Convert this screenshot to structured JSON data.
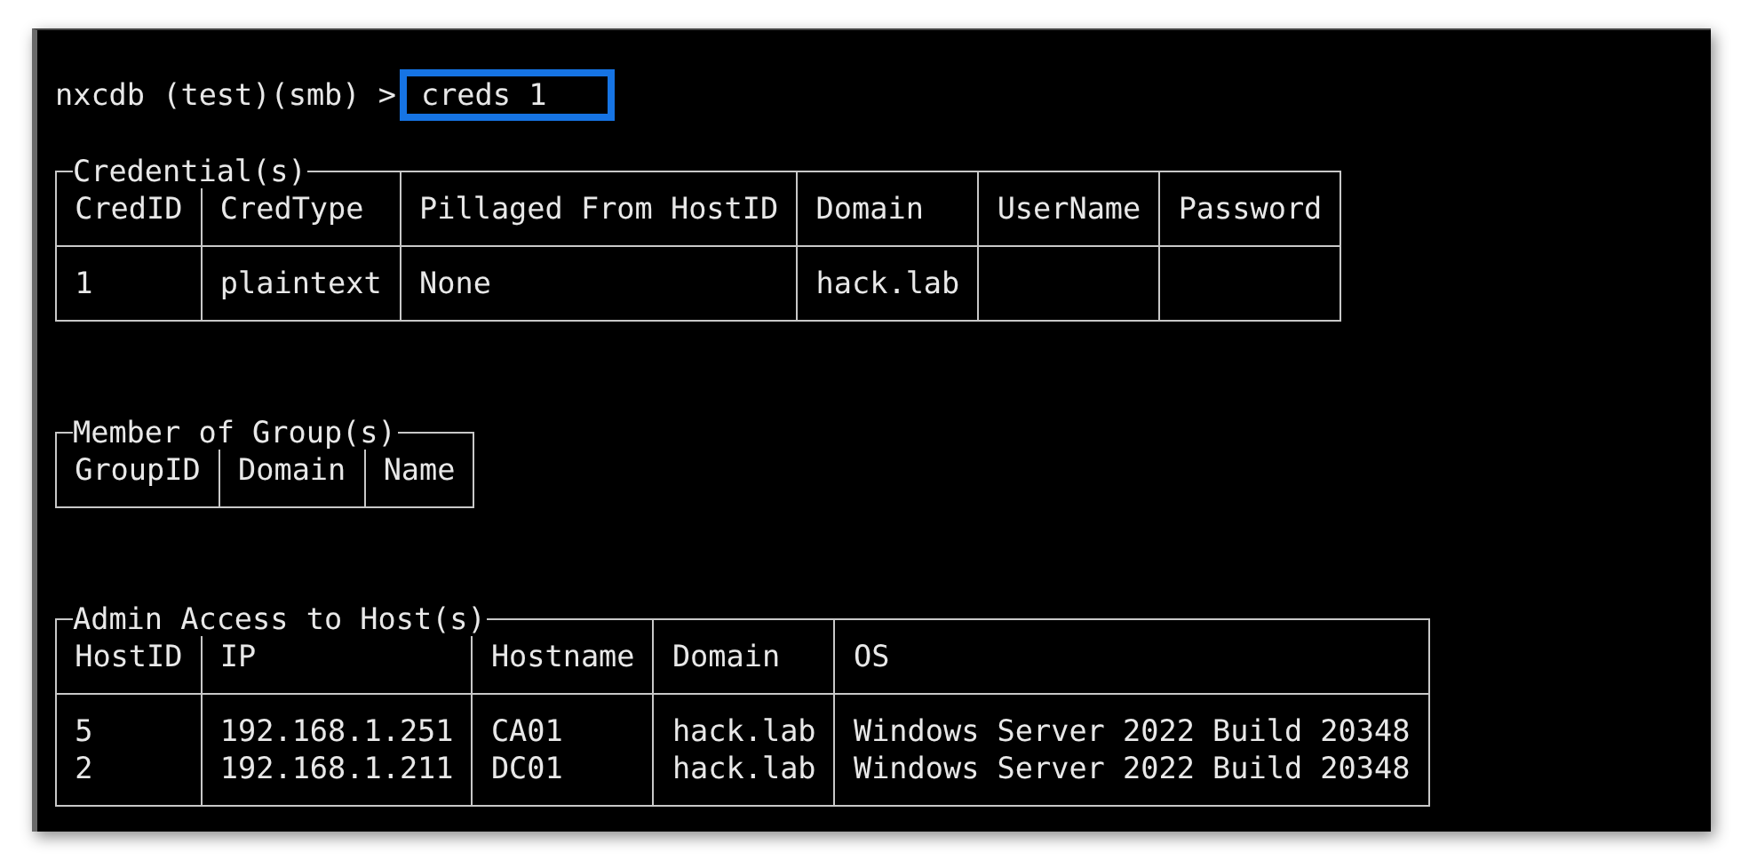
{
  "prompt": {
    "text": "nxcdb (test)(smb) >",
    "command": "creds 1"
  },
  "tables": [
    {
      "title": "Credential(s)",
      "columns": [
        "CredID",
        "CredType",
        "Pillaged From HostID",
        "Domain",
        "UserName",
        "Password"
      ],
      "rows": [
        [
          "1",
          "plaintext",
          "None",
          "hack.lab",
          null,
          null
        ]
      ]
    },
    {
      "title": "Member of Group(s)",
      "columns": [
        "GroupID",
        "Domain",
        "Name"
      ]
    },
    {
      "title": "Admin Access to Host(s)",
      "columns": [
        "HostID",
        "IP",
        "Hostname",
        "Domain",
        "OS"
      ],
      "rows": [
        [
          "5",
          "192.168.1.251",
          "CA01",
          "hack.lab",
          "Windows Server 2022 Build 20348"
        ],
        [
          "2",
          "192.168.1.211",
          "DC01",
          "hack.lab",
          "Windows Server 2022 Build 20348"
        ]
      ]
    }
  ]
}
